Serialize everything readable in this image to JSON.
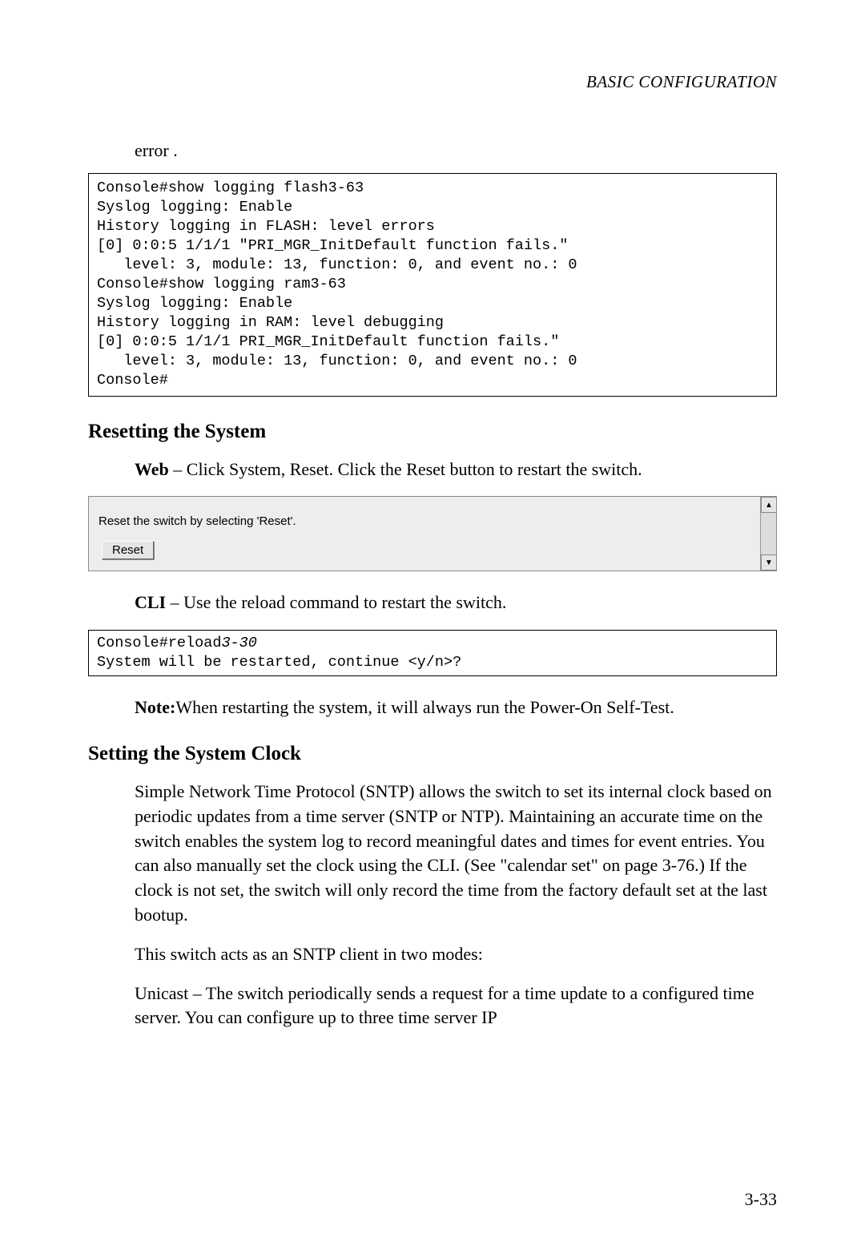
{
  "header": {
    "section_title": "BASIC CONFIGURATION"
  },
  "error_label": "error .",
  "code1": "Console#show logging flash3-63\nSyslog logging: Enable\nHistory logging in FLASH: level errors\n[0] 0:0:5 1/1/1 \"PRI_MGR_InitDefault function fails.\"\n   level: 3, module: 13, function: 0, and event no.: 0\nConsole#show logging ram3-63\nSyslog logging: Enable\nHistory logging in RAM: level debugging\n[0] 0:0:5 1/1/1 PRI_MGR_InitDefault function fails.\"\n   level: 3, module: 13, function: 0, and event no.: 0\nConsole#",
  "heading1": "Resetting the System",
  "web_text": {
    "prefix": "Web",
    "rest": " – Click System, Reset. Click the Reset button to restart the switch."
  },
  "gui": {
    "instruction": "Reset the switch by selecting 'Reset'.",
    "button_label": "Reset"
  },
  "cli_text": {
    "prefix": "CLI",
    "rest": " – Use the reload command to restart the switch."
  },
  "code2": {
    "line_a": "Console#reload",
    "line_a_italic": "3-30",
    "line_b": "System will be restarted, continue <y/n>?"
  },
  "note_text": {
    "prefix": "Note:",
    "rest": "When restarting the system, it will always run the Power-On Self-Test."
  },
  "heading2": "Setting the System Clock",
  "para1": "Simple Network Time Protocol (SNTP) allows the switch to set its internal clock based on periodic updates from a time server (SNTP or NTP). Maintaining an accurate time on the switch enables the system log to record meaningful dates and times for event entries. You can also manually set the clock using the CLI. (See \"calendar set\" on page 3-76.) If the clock is not set, the switch will only record the time from the factory default set at the last bootup.",
  "para2": "This switch acts as an SNTP client in two modes:",
  "para3": "Unicast – The switch periodically sends a request for a time update to a configured time server. You can configure up to three time server IP",
  "page_number": "3-33",
  "icons": {
    "arrow_up": "▲",
    "arrow_down": "▼"
  }
}
